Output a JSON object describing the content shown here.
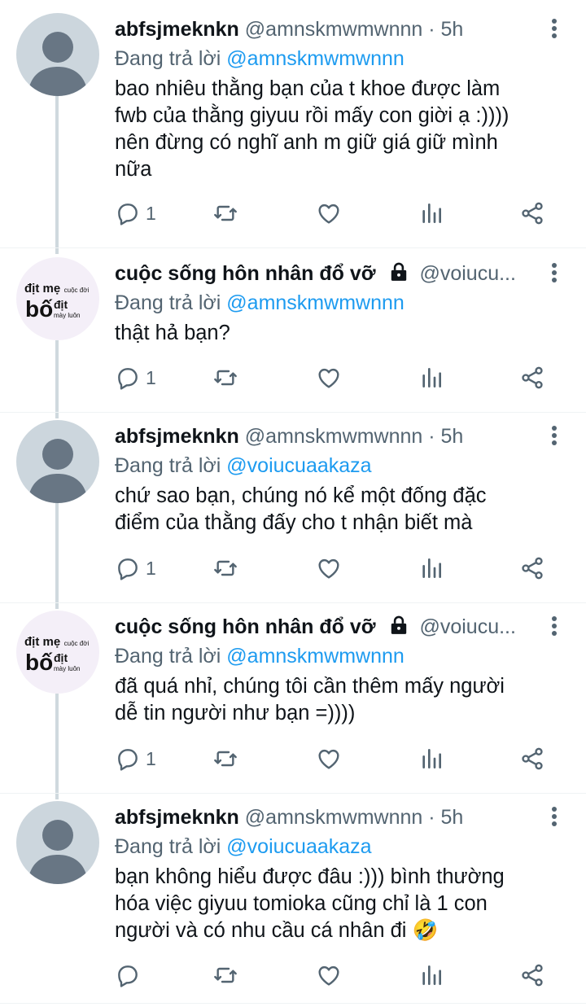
{
  "tweets": [
    {
      "name": "abfsjmeknkn",
      "handle": "@amnskmwmwnnn · 5h",
      "replying_prefix": "Đang trả lời",
      "replying_to": "@amnskmwmwnnn",
      "text": "bao nhiêu thằng bạn của t khoe được làm\nfwb của thằng giyuu rồi mấy con giời ạ :))))\nnên đừng có nghĩ anh m giữ giá giữ mình\nnữa",
      "reply_count": "1"
    },
    {
      "name": "cuộc sống hôn nhân đổ vỡ",
      "handle": "@voiucu...",
      "replying_prefix": "Đang trả lời",
      "replying_to": "@amnskmwmwnnn",
      "text": "thật hả bạn?",
      "reply_count": "1"
    },
    {
      "name": "abfsjmeknkn",
      "handle": "@amnskmwmwnnn · 5h",
      "replying_prefix": "Đang trả lời",
      "replying_to": "@voiucuaakaza",
      "text": "chứ sao bạn, chúng nó kể một đống đặc\nđiểm của thằng đấy cho t nhận biết mà",
      "reply_count": "1"
    },
    {
      "name": "cuộc sống hôn nhân đổ vỡ",
      "handle": "@voiucu...",
      "replying_prefix": "Đang trả lời",
      "replying_to": "@amnskmwmwnnn",
      "text": "đã quá nhỉ, chúng tôi cần thêm mấy người\ndễ tin người như bạn =))))",
      "reply_count": "1"
    },
    {
      "name": "abfsjmeknkn",
      "handle": "@amnskmwmwnnn · 5h",
      "replying_prefix": "Đang trả lời",
      "replying_to": "@voiucuaakaza",
      "text": "bạn không hiểu được đâu :))) bình thường\nhóa việc giyuu tomioka cũng chỉ là 1 con\nngười và có nhu cầu cá nhân đi 🤣",
      "reply_count": ""
    }
  ],
  "page_avatar": {
    "line1_big": "địt mẹ",
    "line1_small": "cuộc đời",
    "line2_big": "bố",
    "line2_mid": "địt",
    "line2_small": "mày luôn"
  },
  "icons": {
    "reply": "speech-bubble-icon",
    "retweet": "retweet-arrows-icon",
    "like": "heart-icon",
    "views": "bar-chart-icon",
    "share": "share-nodes-icon",
    "more": "vertical-dots-icon",
    "lock": "padlock-icon"
  },
  "colors": {
    "link": "#1d9bf0",
    "secondary": "#536471",
    "thread_line": "#cfd9de",
    "avatar_default": "#ccd6dd"
  }
}
